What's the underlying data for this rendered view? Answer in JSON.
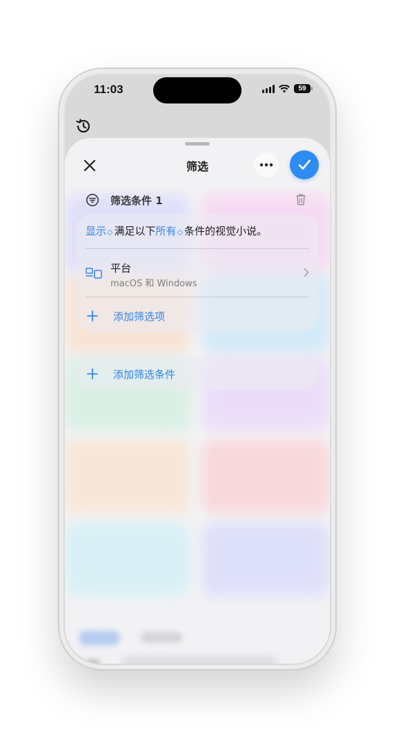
{
  "status_bar": {
    "time": "11:03",
    "battery": "59"
  },
  "sheet": {
    "title": "筛选",
    "close_icon": "close-icon",
    "more_icon": "ellipsis-icon",
    "done_icon": "checkmark-icon"
  },
  "condition": {
    "header_label": "筛选条件 1",
    "sentence": {
      "show_option": "显示",
      "text_1": "满足以下",
      "match_option": "所有",
      "text_2": "条件的视觉小说。"
    },
    "filter_item": {
      "title": "平台",
      "value": "macOS 和 Windows"
    },
    "add_filter_label": "添加筛选项"
  },
  "add_condition_label": "添加筛选条件",
  "colors": {
    "accent": "#2E8BF0",
    "link": "#2F86EA"
  }
}
